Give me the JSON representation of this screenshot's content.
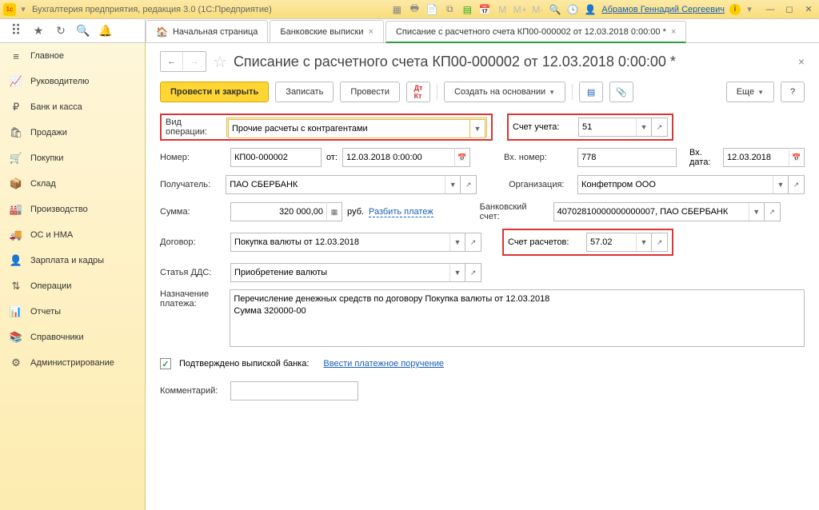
{
  "titlebar": {
    "app_title": "Бухгалтерия предприятия, редакция 3.0 (1С:Предприятие)",
    "user": "Абрамов Геннадий Сергеевич"
  },
  "tabs": {
    "home": "Начальная страница",
    "t1": "Банковские выписки",
    "t2": "Списание с расчетного счета КП00-000002 от 12.03.2018 0:00:00 *"
  },
  "sidebar": {
    "items": [
      {
        "icon": "≡",
        "label": "Главное"
      },
      {
        "icon": "📈",
        "label": "Руководителю"
      },
      {
        "icon": "₽",
        "label": "Банк и касса"
      },
      {
        "icon": "🛍",
        "label": "Продажи"
      },
      {
        "icon": "🛒",
        "label": "Покупки"
      },
      {
        "icon": "📦",
        "label": "Склад"
      },
      {
        "icon": "🏭",
        "label": "Производство"
      },
      {
        "icon": "🚚",
        "label": "ОС и НМА"
      },
      {
        "icon": "👤",
        "label": "Зарплата и кадры"
      },
      {
        "icon": "⇅",
        "label": "Операции"
      },
      {
        "icon": "📊",
        "label": "Отчеты"
      },
      {
        "icon": "📚",
        "label": "Справочники"
      },
      {
        "icon": "⚙",
        "label": "Администрирование"
      }
    ]
  },
  "page": {
    "title": "Списание с расчетного счета КП00-000002 от 12.03.2018 0:00:00 *",
    "btn_post_close": "Провести и закрыть",
    "btn_save": "Записать",
    "btn_post": "Провести",
    "btn_base": "Создать на основании",
    "btn_more": "Еще",
    "btn_help": "?"
  },
  "form": {
    "op_type_label": "Вид операции:",
    "op_type": "Прочие расчеты с контрагентами",
    "account_label": "Счет учета:",
    "account": "51",
    "number_label": "Номер:",
    "number": "КП00-000002",
    "from_label": "от:",
    "date": "12.03.2018  0:00:00",
    "in_number_label": "Вх. номер:",
    "in_number": "778",
    "in_date_label": "Вх. дата:",
    "in_date": "12.03.2018",
    "recipient_label": "Получатель:",
    "recipient": "ПАО СБЕРБАНК",
    "org_label": "Организация:",
    "org": "Конфетпром ООО",
    "sum_label": "Сумма:",
    "sum": "320 000,00",
    "currency": "руб.",
    "split_link": "Разбить платеж",
    "bank_acc_label": "Банковский счет:",
    "bank_acc": "40702810000000000007, ПАО СБЕРБАНК",
    "contract_label": "Договор:",
    "contract": "Покупка валюты от 12.03.2018",
    "settle_acc_label": "Счет расчетов:",
    "settle_acc": "57.02",
    "dds_label": "Статья ДДС:",
    "dds": "Приобретение валюты",
    "purpose_label": "Назначение платежа:",
    "purpose_line1": "Перечисление денежных средств по договору Покупка валюты от 12.03.2018",
    "purpose_line2": "Сумма 320000-00",
    "confirmed_label": "Подтверждено выпиской банка:",
    "pay_order_link": "Ввести платежное поручение",
    "comment_label": "Комментарий:",
    "comment": ""
  }
}
